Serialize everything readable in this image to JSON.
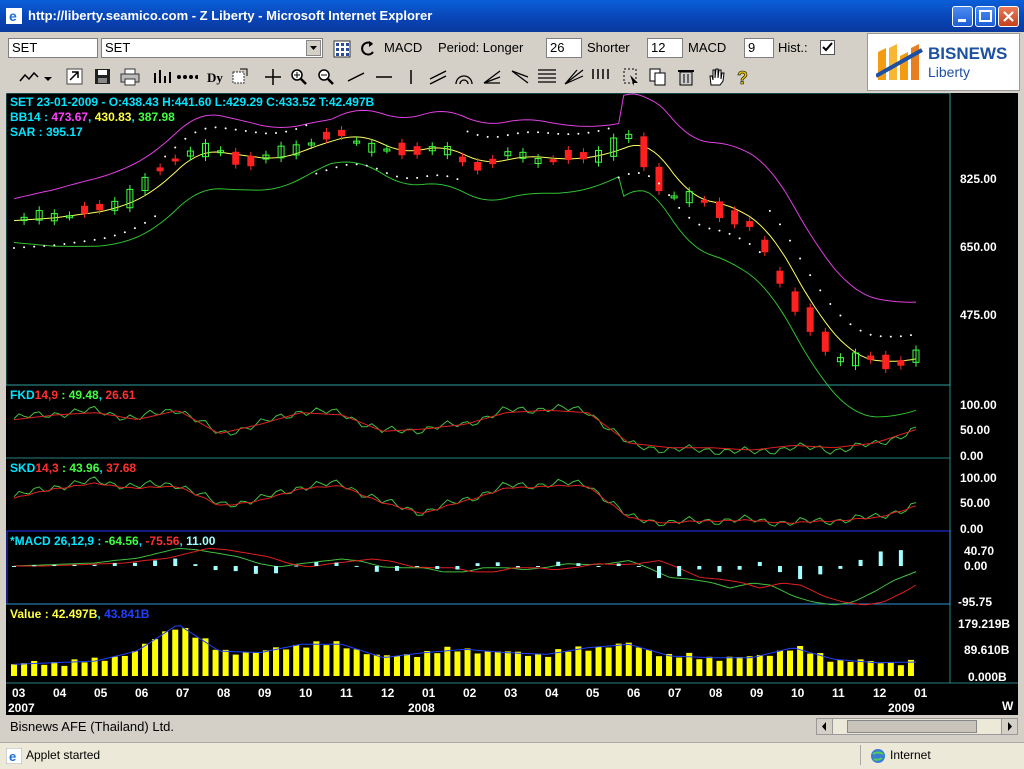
{
  "window": {
    "title": "http://liberty.seamico.com - Z Liberty - Microsoft Internet Explorer"
  },
  "toolbar": {
    "symbol_value": "SET",
    "symbol_select_value": "SET",
    "indicator": "MACD",
    "period_label": "Period: Longer",
    "longer_value": "26",
    "shorter_label": "Shorter",
    "shorter_value": "12",
    "macd_label": "MACD",
    "macd_value": "9",
    "hist_label": "Hist.:",
    "hist_checked": true,
    "icons": [
      "line-chart-icon",
      "dropdown-arrow-icon",
      "open-icon",
      "save-icon",
      "print-icon",
      "chart-type-icon",
      "dots-icon",
      "dy-icon",
      "export-icon",
      "crosshair-icon",
      "zoom-in-icon",
      "zoom-out-icon",
      "trendline-icon",
      "horizontal-line-icon",
      "vertical-line-icon",
      "channel-icon",
      "arc-icon",
      "fan-icon",
      "speed-line-icon",
      "fibonacci-icon",
      "gann-icon",
      "cycle-icon",
      "select-icon",
      "copy-icon",
      "delete-icon",
      "hand-icon",
      "help-icon"
    ]
  },
  "logo": {
    "brand": "BISNEWS",
    "sub": "Liberty"
  },
  "chart": {
    "header_line": "SET 23-01-2009 - O:438.43 H:441.60 L:429.29 C:433.52 T:42.497B",
    "bb_label": "BB14 : ",
    "bb_values": [
      "473.67",
      "430.83",
      "387.98"
    ],
    "sar_label": "SAR : 395.17",
    "price_ticks": [
      "825.00",
      "650.00",
      "475.00"
    ],
    "fkd_label": "FKD",
    "fkd_params": "14,9",
    "fkd_v1": " : 49.48",
    "fkd_v2": "26.61",
    "fkd_ticks": [
      "100.00",
      "50.00",
      "0.00"
    ],
    "skd_label": "SKD",
    "skd_params": "14,3",
    "skd_v1": " : 43.96",
    "skd_v2": "37.68",
    "skd_ticks": [
      "100.00",
      "50.00",
      "0.00"
    ],
    "macd_label": "*MACD 26,12,9 : ",
    "macd_v1": "-64.56",
    "macd_v2": "-75.56",
    "macd_v3": "11.00",
    "macd_ticks": [
      "40.70",
      "0.00",
      "-95.75"
    ],
    "value_label": "Value : 42.497B",
    "value_v2": "43.841B",
    "value_ticks": [
      "179.219B",
      "89.610B",
      "0.000B"
    ],
    "months": [
      "03",
      "04",
      "05",
      "06",
      "07",
      "08",
      "09",
      "10",
      "11",
      "12",
      "01",
      "02",
      "03",
      "04",
      "05",
      "06",
      "07",
      "08",
      "09",
      "10",
      "11",
      "12",
      "01"
    ],
    "years": [
      "2007",
      "2008",
      "2009"
    ],
    "period_btn": "W"
  },
  "chart_data": {
    "type": "line",
    "x": [
      "03",
      "04",
      "05",
      "06",
      "07",
      "08",
      "09",
      "10",
      "11",
      "12",
      "01",
      "02",
      "03",
      "04",
      "05",
      "06",
      "07",
      "08",
      "09",
      "10",
      "11",
      "12",
      "01"
    ],
    "series": [
      {
        "name": "SET",
        "values": [
          680,
          690,
          700,
          735,
          810,
          800,
          790,
          820,
          840,
          800,
          820,
          780,
          800,
          790,
          800,
          830,
          720,
          710,
          660,
          520,
          430,
          420,
          435
        ]
      },
      {
        "name": "FKD 14,9",
        "values": [
          70,
          80,
          85,
          70,
          90,
          40,
          60,
          85,
          80,
          45,
          50,
          60,
          85,
          90,
          85,
          20,
          10,
          10,
          5,
          15,
          10,
          20,
          49
        ]
      },
      {
        "name": "SKD 14,3",
        "values": [
          60,
          80,
          90,
          80,
          85,
          45,
          55,
          80,
          85,
          50,
          30,
          55,
          80,
          85,
          85,
          20,
          10,
          15,
          15,
          10,
          15,
          20,
          44
        ]
      },
      {
        "name": "Value",
        "values": [
          35,
          40,
          45,
          75,
          155,
          75,
          70,
          95,
          95,
          55,
          70,
          80,
          70,
          65,
          85,
          95,
          60,
          55,
          55,
          85,
          50,
          40,
          42
        ]
      }
    ],
    "ylim": [
      380,
      900
    ]
  },
  "footer": {
    "company": "Bisnews AFE (Thailand) Ltd."
  },
  "status": {
    "left": "Applet started",
    "right": "Internet"
  }
}
